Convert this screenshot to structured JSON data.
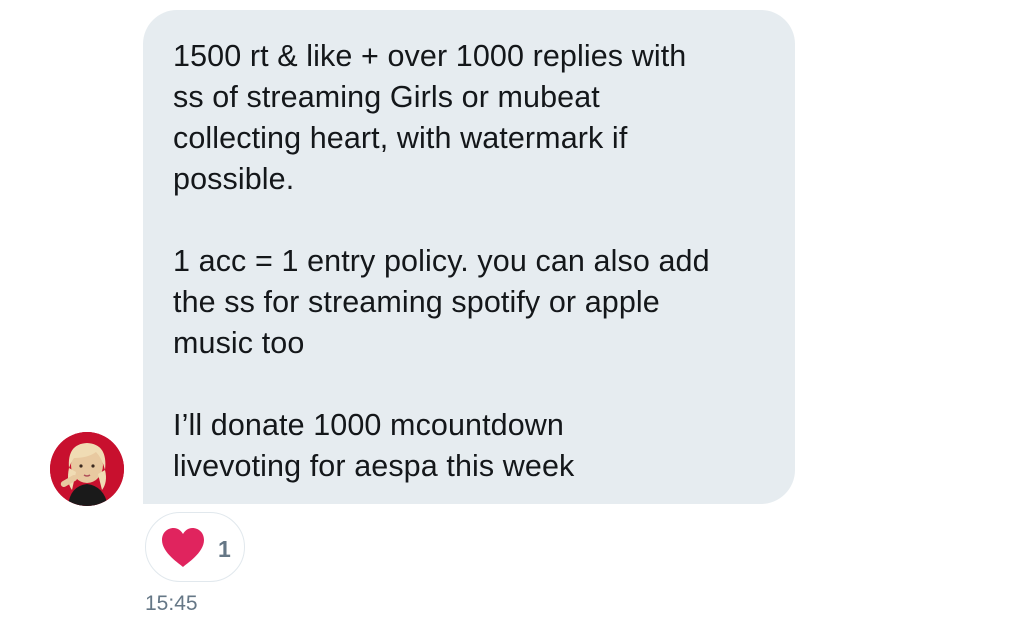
{
  "message": {
    "paragraphs": [
      {
        "lines": [
          "1500 rt & like + over 1000 replies with",
          "ss of streaming Girls or mubeat",
          "collecting heart, with watermark if",
          "possible."
        ]
      },
      {
        "lines": [
          "1 acc = 1 entry policy. you can also add",
          "the ss for streaming spotify or apple",
          "music too"
        ]
      },
      {
        "lines": [
          "I’ll donate 1000 mcountdown",
          "livevoting for aespa this week"
        ]
      }
    ],
    "reaction": {
      "icon": "heart-icon",
      "count": "1",
      "color": "#e0245e"
    },
    "timestamp": "15:45",
    "bubble_color": "#e6ecf0",
    "avatar_bg": "#c8102e"
  }
}
